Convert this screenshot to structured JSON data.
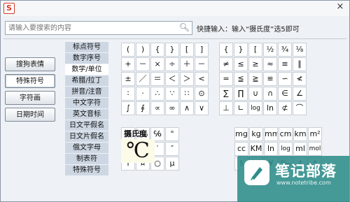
{
  "window": {
    "close_symbol": "×"
  },
  "search": {
    "placeholder": "请输入要搜索的内容",
    "icon": "search-icon"
  },
  "hint": "快捷输入：输入“摄氏度”选5即可",
  "left_buttons": [
    "搜狗表情",
    "特殊符号",
    "字符画",
    "日期时间"
  ],
  "categories": [
    "标点符号",
    "数字序号",
    "数学/单位",
    "希腊/拉丁",
    "拼音/注音",
    "中文字符",
    "英文音标",
    "日文平假名",
    "日文片假名",
    "俄文字母",
    "制表符",
    "特殊符号"
  ],
  "selected_category": "数学/单位",
  "grid1": [
    [
      "(",
      ")",
      "{",
      "}",
      "[",
      "]"
    ],
    [
      "+",
      "－",
      "×",
      "÷",
      "＋",
      "－"
    ],
    [
      "±",
      "／",
      "＝",
      "＜",
      "＞",
      "<"
    ],
    [
      "∶",
      "·",
      "∴",
      "∵",
      "∷",
      "⊙"
    ],
    [
      "∫",
      "∮",
      "∝",
      "∞",
      "∧",
      "∨"
    ]
  ],
  "grid2": [
    [
      "{",
      "}",
      "[",
      "½",
      "¾",
      "⅛"
    ],
    [
      "≠",
      "≤",
      "≥",
      "≈",
      "≡",
      "∥"
    ],
    [
      "=",
      "≦",
      "≧",
      "≌",
      "∽",
      "≮"
    ],
    [
      "∑",
      "∏",
      "∪",
      "∩",
      "∈",
      "∠"
    ],
    [
      "⊥",
      "∟",
      "log",
      "ln",
      "⊄",
      "⌒"
    ]
  ],
  "grid3": [
    [
      "%",
      "‰",
      "℅",
      "°"
    ],
    [
      "℃",
      "℉",
      "′",
      "″"
    ],
    [
      "〒",
      "¤",
      "○",
      "µ"
    ]
  ],
  "grid4": [
    [
      "mg",
      "kg",
      "mm",
      "cm",
      "km",
      "m²"
    ],
    [
      "cc",
      "KM",
      "ln",
      "log",
      "ml",
      "mol"
    ],
    [
      "$",
      "£",
      "¥",
      "‰",
      "†",
      "‡"
    ]
  ],
  "preview": {
    "title": "摄氏度",
    "symbol": "℃"
  },
  "watermark": {
    "title": "笔记部落",
    "url": "www.notetribe.com"
  }
}
